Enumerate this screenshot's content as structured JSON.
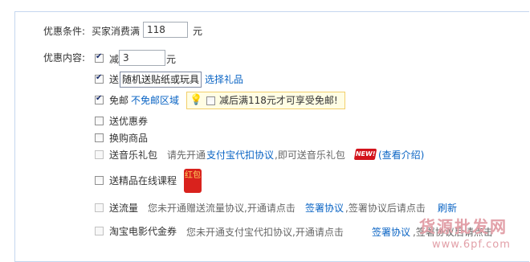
{
  "condition": {
    "label": "优惠条件:",
    "prefix": "买家消费满",
    "amount": "118",
    "unit": "元"
  },
  "content_label": "优惠内容:",
  "options": {
    "reduce": {
      "label": "减",
      "value": "3",
      "unit": "元",
      "checked": true
    },
    "gift": {
      "label": "送",
      "tooltip": "随机送贴纸或玩具",
      "link": "选择礼品",
      "checked": true
    },
    "free_shipping": {
      "label": "免邮",
      "link": "不免邮区域",
      "notice": "减后满118元才可享受免邮!",
      "checked": true
    },
    "coupon": {
      "label": "送优惠券",
      "checked": false
    },
    "exchange": {
      "label": "换购商品",
      "checked": false
    },
    "music_gift": {
      "label": "送音乐礼包",
      "desc_pre": "请先开通",
      "desc_link": "支付宝代扣协议",
      "desc_post": ",即可送音乐礼包",
      "badge": "NEW!",
      "intro_link": "(查看介绍)",
      "checked": false
    },
    "course": {
      "label": "送精品在线课程",
      "badge_icon": "红包",
      "checked": false
    },
    "traffic": {
      "label": "送流量",
      "desc_pre": "您未开通赠送流量协议,开通请点击",
      "sign_link": "签署协议",
      "desc_mid": ",签署协议后请点击",
      "refresh_link": "刷新",
      "checked": false
    },
    "movie": {
      "label": "淘宝电影代金券",
      "desc_pre": "您未开通支付宝代扣协议,开通请点击",
      "sign_link": "签署协议",
      "desc_mid": ",签署协议后请点击",
      "refresh_link": "刷新",
      "checked": false
    }
  },
  "watermark": {
    "line1": "货源批发网",
    "line2": "www.6pf.com"
  },
  "colors": {
    "link": "#0a64c4",
    "border": "#c5d7ef",
    "notice_bg": "#fffde4",
    "badge_red": "#d3141c"
  }
}
